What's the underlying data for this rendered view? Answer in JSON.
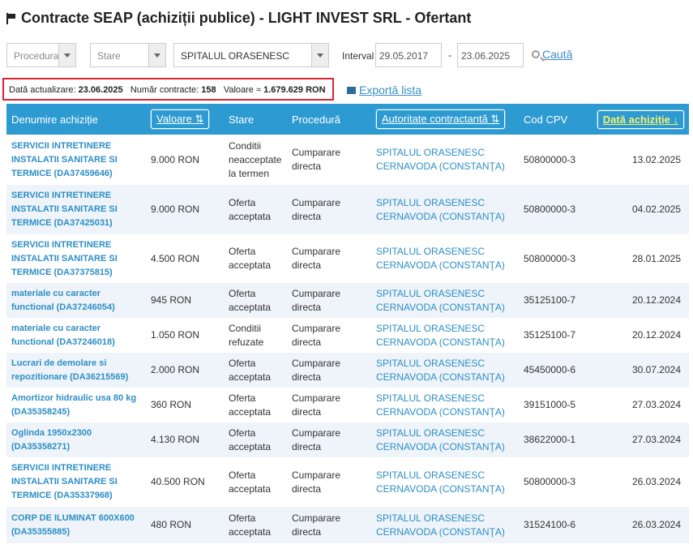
{
  "header": {
    "title": "Contracte SEAP (achiziții publice) - LIGHT INVEST SRL - Ofertant"
  },
  "filters": {
    "procedura": "Procedura",
    "stare": "Stare",
    "autoritate": "SPITALUL ORASENESC",
    "interval_label": "Interval",
    "date_from": "29.05.2017",
    "date_to": "23.06.2025",
    "dash": "-",
    "search_label": "Caută"
  },
  "summary": {
    "updated_label": "Dată actualizare:",
    "updated_value": "23.06.2025",
    "count_label": "Număr contracte:",
    "count_value": "158",
    "value_label": "Valoare ≈",
    "value_value": "1.679.629 RON"
  },
  "export_label": "Exportă lista",
  "table": {
    "headers": {
      "name": "Denumire achiziție",
      "value": "Valoare ⇅",
      "status": "Stare",
      "procedure": "Procedură",
      "authority": "Autoritate contractantă ⇅",
      "cpv": "Cod CPV",
      "date": "Dată achiziție ↓"
    },
    "rows": [
      {
        "name": "SERVICII INTRETINERE INSTALATII SANITARE SI TERMICE (DA37459646)",
        "value": "9.000 RON",
        "status": "Conditii neacceptate la termen",
        "procedure": "Cumparare directa",
        "authority": "SPITALUL ORASENESC CERNAVODA (CONSTANŢA)",
        "cpv": "50800000-3",
        "date": "13.02.2025"
      },
      {
        "name": "SERVICII INTRETINERE INSTALATII SANITARE SI TERMICE (DA37425031)",
        "value": "9.000 RON",
        "status": "Oferta acceptata",
        "procedure": "Cumparare directa",
        "authority": "SPITALUL ORASENESC CERNAVODA (CONSTANŢA)",
        "cpv": "50800000-3",
        "date": "04.02.2025"
      },
      {
        "name": "SERVICII INTRETINERE INSTALATII SANITARE SI TERMICE (DA37375815)",
        "value": "4.500 RON",
        "status": "Oferta acceptata",
        "procedure": "Cumparare directa",
        "authority": "SPITALUL ORASENESC CERNAVODA (CONSTANŢA)",
        "cpv": "50800000-3",
        "date": "28.01.2025"
      },
      {
        "name": "materiale cu caracter functional (DA37246054)",
        "value": "945 RON",
        "status": "Oferta acceptata",
        "procedure": "Cumparare directa",
        "authority": "SPITALUL ORASENESC CERNAVODA (CONSTANŢA)",
        "cpv": "35125100-7",
        "date": "20.12.2024"
      },
      {
        "name": "materiale cu caracter functional (DA37246018)",
        "value": "1.050 RON",
        "status": "Conditii refuzate",
        "procedure": "Cumparare directa",
        "authority": "SPITALUL ORASENESC CERNAVODA (CONSTANŢA)",
        "cpv": "35125100-7",
        "date": "20.12.2024"
      },
      {
        "name": "Lucrari de demolare si repozitionare (DA36215569)",
        "value": "2.000 RON",
        "status": "Oferta acceptata",
        "procedure": "Cumparare directa",
        "authority": "SPITALUL ORASENESC CERNAVODA (CONSTANŢA)",
        "cpv": "45450000-6",
        "date": "30.07.2024"
      },
      {
        "name": "Amortizor hidraulic usa 80 kg (DA35358245)",
        "value": "360 RON",
        "status": "Oferta acceptata",
        "procedure": "Cumparare directa",
        "authority": "SPITALUL ORASENESC CERNAVODA (CONSTANŢA)",
        "cpv": "39151000-5",
        "date": "27.03.2024"
      },
      {
        "name": "Oglinda 1950x2300 (DA35358271)",
        "value": "4.130 RON",
        "status": "Oferta acceptata",
        "procedure": "Cumparare directa",
        "authority": "SPITALUL ORASENESC CERNAVODA (CONSTANŢA)",
        "cpv": "38622000-1",
        "date": "27.03.2024"
      },
      {
        "name": "SERVICII INTRETINERE INSTALATII SANITARE SI TERMICE (DA35337968)",
        "value": "40.500 RON",
        "status": "Oferta acceptata",
        "procedure": "Cumparare directa",
        "authority": "SPITALUL ORASENESC CERNAVODA (CONSTANŢA)",
        "cpv": "50800000-3",
        "date": "26.03.2024"
      },
      {
        "name": "CORP DE ILUMINAT 600X600 (DA35355885)",
        "value": "480 RON",
        "status": "Oferta acceptata",
        "procedure": "Cumparare directa",
        "authority": "SPITALUL ORASENESC CERNAVODA (CONSTANŢA)",
        "cpv": "31524100-6",
        "date": "26.03.2024"
      }
    ]
  }
}
